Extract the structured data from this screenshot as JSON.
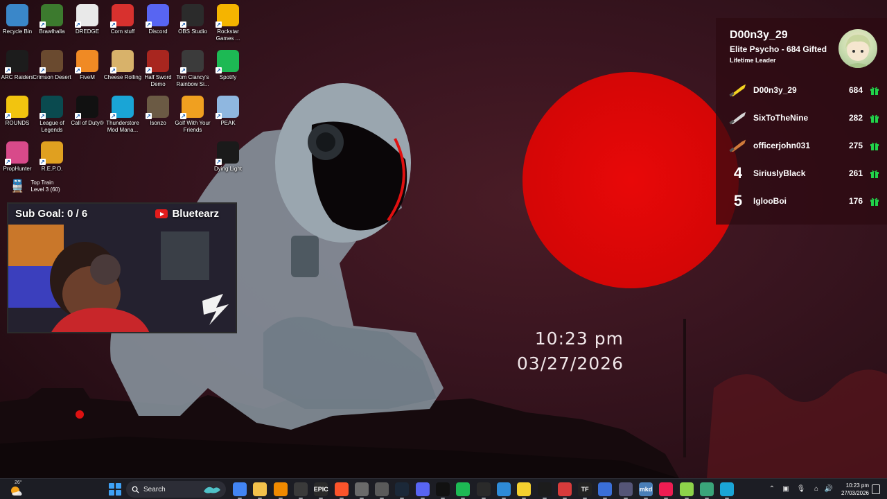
{
  "desktop": {
    "icons": [
      {
        "label": "Recycle Bin",
        "icon": "recycle-bin-icon",
        "color": "#3a87c9"
      },
      {
        "label": "Brawlhalla",
        "icon": "brawlhalla-icon",
        "color": "#3c7a2e"
      },
      {
        "label": "DREDGE",
        "icon": "dredge-icon",
        "color": "#e9e9e9"
      },
      {
        "label": "Corn stuff",
        "icon": "corn-stuff-icon",
        "color": "#d8312e"
      },
      {
        "label": "Discord",
        "icon": "discord-icon",
        "color": "#5865f2"
      },
      {
        "label": "OBS Studio",
        "icon": "obs-studio-icon",
        "color": "#2b2b2b"
      },
      {
        "label": "Rockstar Games ...",
        "icon": "rockstar-games-icon",
        "color": "#f5b400"
      },
      {
        "label": "ARC Raiders",
        "icon": "arc-raiders-icon",
        "color": "#1c1c1c"
      },
      {
        "label": "Crimson Desert",
        "icon": "crimson-desert-icon",
        "color": "#6a4a2f"
      },
      {
        "label": "FiveM",
        "icon": "fivem-icon",
        "color": "#f08a24"
      },
      {
        "label": "Cheese Rolling",
        "icon": "cheese-rolling-icon",
        "color": "#d8b26a"
      },
      {
        "label": "Half Sword Demo",
        "icon": "half-sword-demo-icon",
        "color": "#a8261f"
      },
      {
        "label": "Tom Clancy's Rainbow Si...",
        "icon": "rainbow-six-icon",
        "color": "#3b3b3b"
      },
      {
        "label": "Spotify",
        "icon": "spotify-icon",
        "color": "#1db954"
      },
      {
        "label": "ROUNDS",
        "icon": "rounds-icon",
        "color": "#f2c40f"
      },
      {
        "label": "League of Legends",
        "icon": "league-of-legends-icon",
        "color": "#0a4a4f"
      },
      {
        "label": "Call of Duty®",
        "icon": "call-of-duty-icon",
        "color": "#111111"
      },
      {
        "label": "Thunderstore Mod Mana...",
        "icon": "thunderstore-icon",
        "color": "#1aa5d6"
      },
      {
        "label": "Isonzo",
        "icon": "isonzo-icon",
        "color": "#6b5a44"
      },
      {
        "label": "Golf With Your Friends",
        "icon": "golf-with-your-friends-icon",
        "color": "#f0a020"
      },
      {
        "label": "PEAK",
        "icon": "peak-icon",
        "color": "#8fb7e0"
      },
      {
        "label": "PropHunter",
        "icon": "prophunter-icon",
        "color": "#d84a8a"
      },
      {
        "label": "R.E.P.O.",
        "icon": "repo-icon",
        "color": "#e0a020"
      },
      {
        "label": "Dying Light",
        "icon": "dying-light-icon",
        "color": "#1a1a1a"
      }
    ]
  },
  "top_train": {
    "line1": "Top Train",
    "line2": "Level 3 (60)"
  },
  "webcam": {
    "subgoal": "Sub Goal: 0 / 6",
    "channel": "Bluetearz"
  },
  "leaderboard": {
    "name": "D00n3y_29",
    "subtitle": "Elite Psycho - 684 Gifted",
    "title": "Lifetime Leader",
    "rows": [
      {
        "rank": "",
        "rank_icon": "gold-knife-icon",
        "user": "D00n3y_29",
        "count": "684"
      },
      {
        "rank": "",
        "rank_icon": "silver-knife-icon",
        "user": "SixToTheNine",
        "count": "282"
      },
      {
        "rank": "",
        "rank_icon": "bronze-knife-icon",
        "user": "officerjohn031",
        "count": "275"
      },
      {
        "rank": "4",
        "rank_icon": "",
        "user": "SiriuslyBlack",
        "count": "261"
      },
      {
        "rank": "5",
        "rank_icon": "",
        "user": "IglooBoi",
        "count": "176"
      }
    ],
    "gift_color": "#22d34a"
  },
  "clock": {
    "time": "10:23 pm",
    "date": "03/27/2026"
  },
  "taskbar": {
    "weather_temp": "26°",
    "search_placeholder": "Search",
    "apps": [
      {
        "icon": "chrome-icon",
        "color": "#4285f4",
        "text": ""
      },
      {
        "icon": "file-explorer-icon",
        "color": "#f3c14b",
        "text": ""
      },
      {
        "icon": "vlc-icon",
        "color": "#f08a00",
        "text": ""
      },
      {
        "icon": "obs-icon",
        "color": "#3a3a3a",
        "text": ""
      },
      {
        "icon": "epic-games-icon",
        "color": "#2a2a2a",
        "text": "EPIC"
      },
      {
        "icon": "brave-icon",
        "color": "#fb542b",
        "text": ""
      },
      {
        "icon": "notepad-icon",
        "color": "#6a6a6a",
        "text": ""
      },
      {
        "icon": "davinci-icon",
        "color": "#5a5a5a",
        "text": ""
      },
      {
        "icon": "steam-icon",
        "color": "#1b2838",
        "text": ""
      },
      {
        "icon": "discord-tb-icon",
        "color": "#5865f2",
        "text": ""
      },
      {
        "icon": "capcut-icon",
        "color": "#111111",
        "text": ""
      },
      {
        "icon": "spotify-tb-icon",
        "color": "#1db954",
        "text": ""
      },
      {
        "icon": "speedometer-icon",
        "color": "#2a2a2a",
        "text": ""
      },
      {
        "icon": "photos-icon",
        "color": "#2e8bd8",
        "text": ""
      },
      {
        "icon": "sticky-notes-icon",
        "color": "#f4d02f",
        "text": ""
      },
      {
        "icon": "game-bar-icon",
        "color": "#1c1c1c",
        "text": ""
      },
      {
        "icon": "medal-icon",
        "color": "#d83b3b",
        "text": ""
      },
      {
        "icon": "tf-icon",
        "color": "#222222",
        "text": "TF"
      },
      {
        "icon": "deckhub-icon",
        "color": "#3a6fd8",
        "text": ""
      },
      {
        "icon": "controller-icon",
        "color": "#555577",
        "text": ""
      },
      {
        "icon": "mkd-icon",
        "color": "#4a7fb8",
        "text": "mkd"
      },
      {
        "icon": "tiktok-icon",
        "color": "#ee1d52",
        "text": ""
      },
      {
        "icon": "chat-icon",
        "color": "#8dd34a",
        "text": ""
      },
      {
        "icon": "app-manager-icon",
        "color": "#3aa57a",
        "text": ""
      },
      {
        "icon": "thunderstore-tb-icon",
        "color": "#1aa5d6",
        "text": ""
      }
    ],
    "tray_time": "10:23 pm",
    "tray_date": "27/03/2026"
  }
}
